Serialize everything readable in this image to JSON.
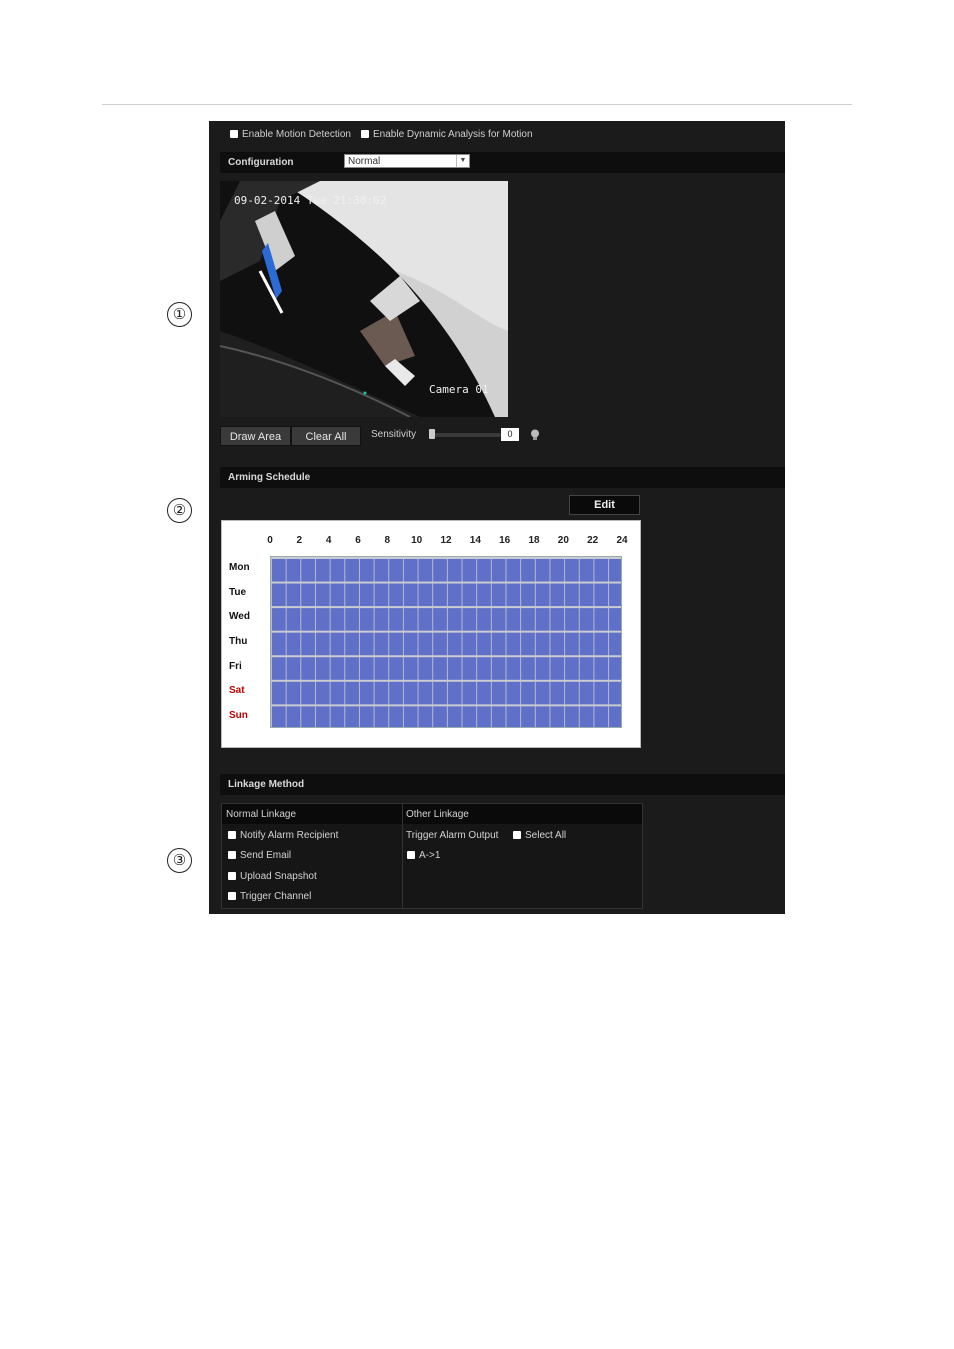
{
  "callouts": [
    "①",
    "②",
    "③"
  ],
  "motion": {
    "enable_motion_detection": "Enable Motion Detection",
    "enable_dynamic_analysis": "Enable Dynamic Analysis for Motion"
  },
  "configuration": {
    "label": "Configuration",
    "selected": "Normal"
  },
  "video": {
    "timestamp": "09-02-2014 Tue 21:30:02",
    "camera_name": "Camera 01"
  },
  "controls": {
    "draw_area": "Draw Area",
    "clear_all": "Clear All",
    "sensitivity_label": "Sensitivity",
    "sensitivity_value": "0"
  },
  "arming": {
    "title": "Arming Schedule",
    "edit_label": "Edit",
    "hours": [
      "0",
      "2",
      "4",
      "6",
      "8",
      "10",
      "12",
      "14",
      "16",
      "18",
      "20",
      "22",
      "24"
    ],
    "days": [
      "Mon",
      "Tue",
      "Wed",
      "Thu",
      "Fri",
      "Sat",
      "Sun"
    ]
  },
  "linkage": {
    "title": "Linkage Method",
    "normal_header": "Normal Linkage",
    "other_header": "Other Linkage",
    "normal_items": [
      "Notify Alarm Recipient",
      "Send Email",
      "Upload Snapshot",
      "Trigger Channel"
    ],
    "trigger_alarm_output": "Trigger Alarm Output",
    "select_all": "Select All",
    "output_item": "A->1"
  },
  "colors": {
    "panel": "#1b1b1b",
    "schedule_fill": "#6070c8",
    "weekend": "#c00000"
  }
}
